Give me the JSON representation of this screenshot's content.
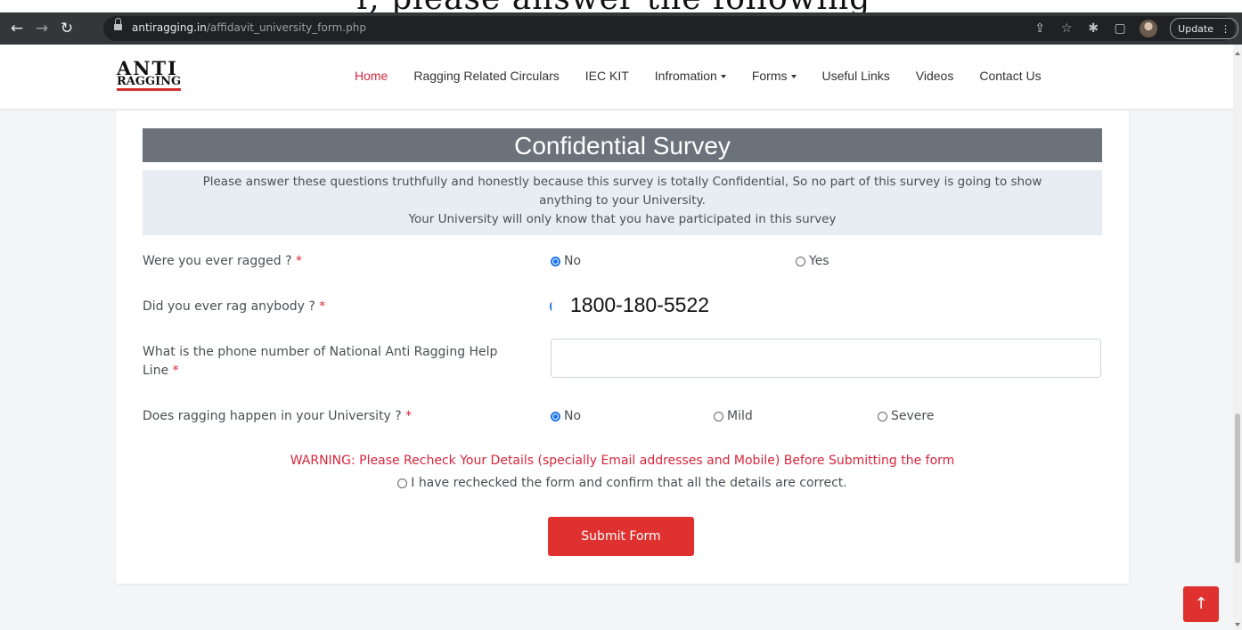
{
  "top_crop_text": "r, please answer the following",
  "browser": {
    "url_host": "antiragging.in",
    "url_path": "/affidavit_university_form.php",
    "update_label": "Update",
    "icons": [
      "back-arrow-icon",
      "forward-arrow-icon",
      "reload-icon",
      "lock-icon",
      "share-icon",
      "star-icon",
      "extensions-icon",
      "side-panel-icon",
      "profile-avatar",
      "menu-dots-icon"
    ]
  },
  "logo": {
    "line1": "ANTI",
    "line2": "RAGGING"
  },
  "nav": {
    "home": "Home",
    "circulars": "Ragging Related Circulars",
    "iec": "IEC KIT",
    "information": "Infromation",
    "forms": "Forms",
    "useful_links": "Useful Links",
    "videos": "Videos",
    "contact": "Contact Us"
  },
  "survey": {
    "title": "Confidential Survey",
    "notice_line1": "Please answer these questions truthfully and honestly because this survey is totally Confidential, So no part of this survey is going to show",
    "notice_line2": "anything to your University.",
    "notice_line3": "Your University will only know that you have participated in this survey",
    "q1": {
      "label": "Were you ever ragged ?",
      "opt_no": "No",
      "opt_yes": "Yes",
      "selected": "No"
    },
    "q2": {
      "label": "Did you ever rag anybody ?",
      "overlay_text": "1800-180-5522"
    },
    "q3": {
      "label_line1": "What is the phone number of National Anti Ragging Help",
      "label_line2": "Line",
      "value": ""
    },
    "q4": {
      "label": "Does ragging happen in your University ?",
      "opt_no": "No",
      "opt_mild": "Mild",
      "opt_severe": "Severe",
      "selected": "No"
    },
    "required_mark": "*",
    "warning": "WARNING: Please Recheck Your Details (specially Email addresses and Mobile) Before Submitting the form",
    "confirm_label": "I have rechecked the form and confirm that all the details are correct.",
    "submit_label": "Submit Form"
  },
  "scroll_top_symbol": "↑",
  "colors": {
    "accent_red": "#e03131",
    "nav_active": "#d7263d",
    "title_bar": "#6c727a",
    "notice_bg": "#e8edf3",
    "radio_checked": "#1a73e8"
  }
}
